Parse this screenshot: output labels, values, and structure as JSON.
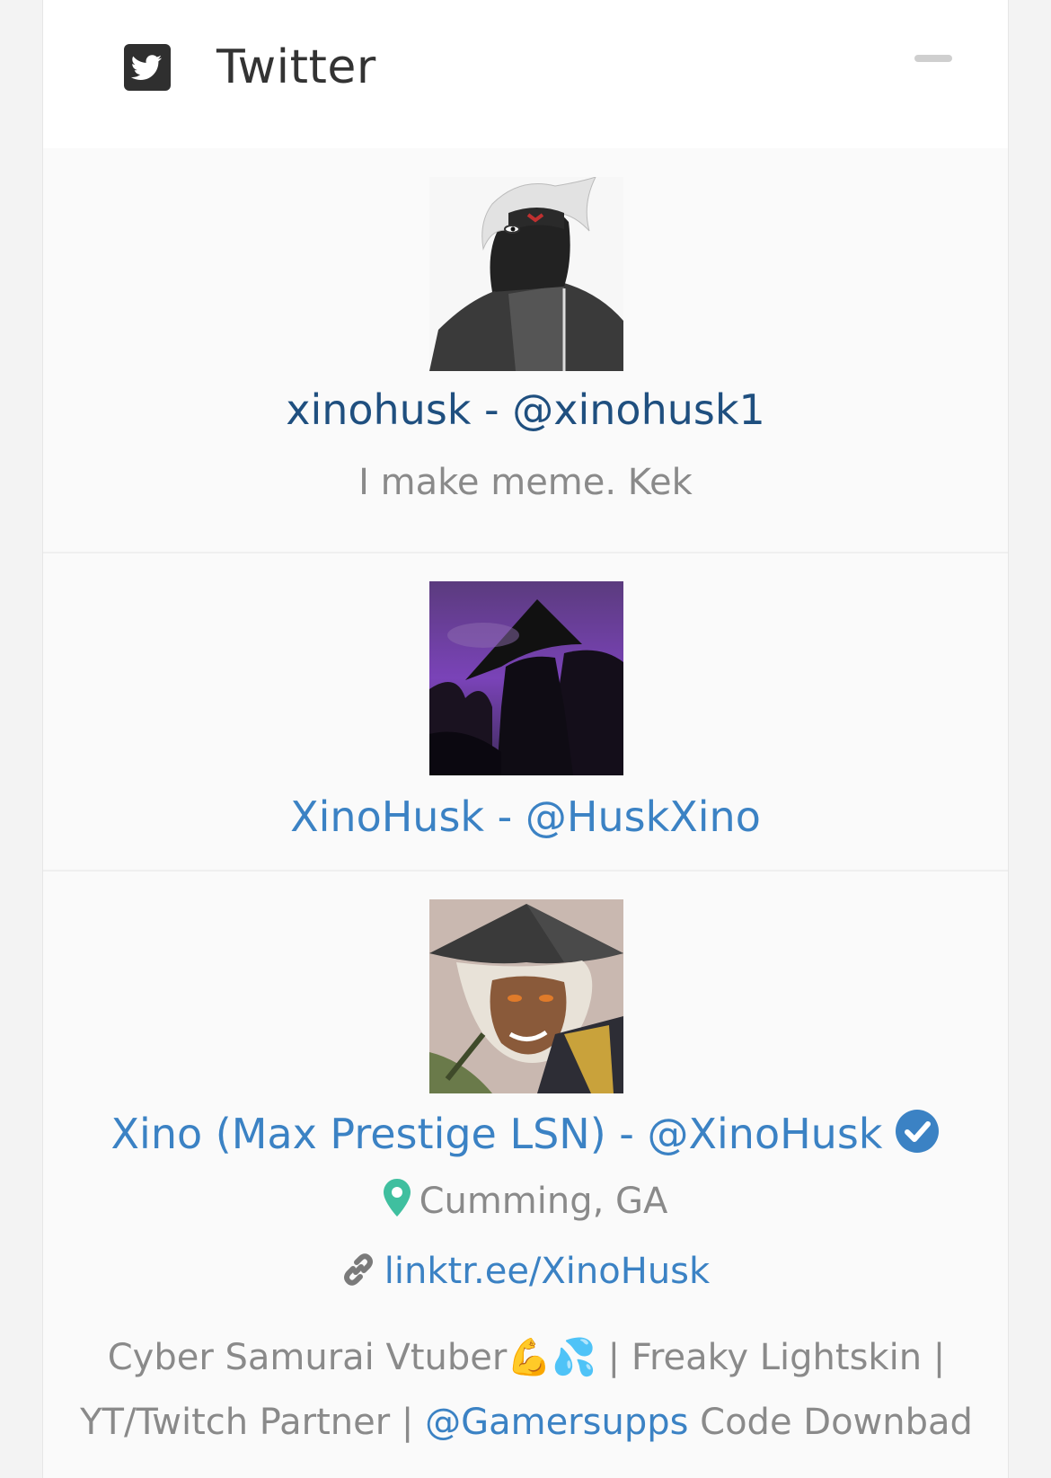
{
  "panel": {
    "title": "Twitter",
    "icon": "twitter-square-icon",
    "collapse_icon": "minus-icon"
  },
  "colors": {
    "link_dark": "#1f4f7f",
    "link": "#3b82c4",
    "muted": "#8a8a8a",
    "location_pin": "#3fbf9f",
    "verified": "#3b82c4"
  },
  "accounts": [
    {
      "display": "xinohusk - @xinohusk1",
      "description": "I make meme. Kek"
    },
    {
      "display": "XinoHusk - @HuskXino"
    },
    {
      "display": "Xino (Max Prestige LSN) - @XinoHusk",
      "verified_icon": "verified-check-icon",
      "location": "Cumming, GA",
      "website": "linktr.ee/XinoHusk",
      "bio_start": "Cyber Samurai Vtuber",
      "bio_emoji": "💪💦",
      "bio_middle": " | Freaky Lightskin | YT/Twitch Partner | ",
      "bio_mention": "@Gamersupps",
      "bio_end": " Code Downbad"
    }
  ]
}
